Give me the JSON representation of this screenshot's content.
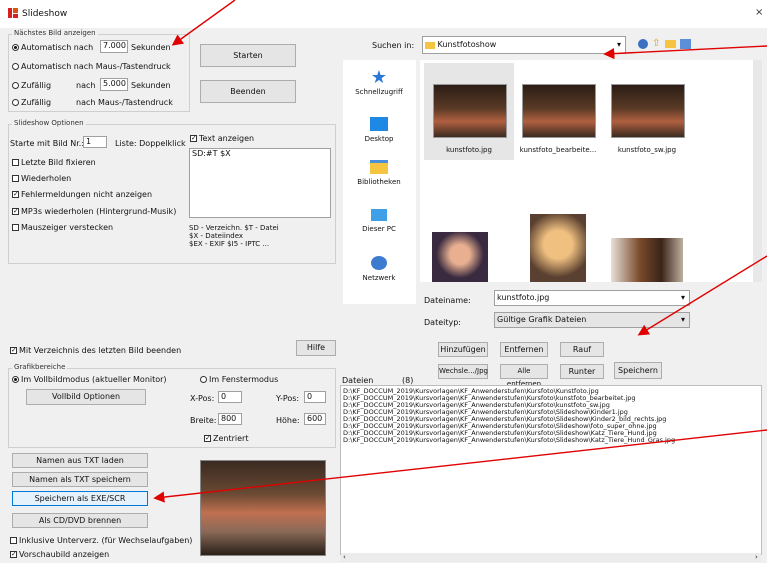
{
  "window": {
    "title": "Slideshow",
    "close": "×"
  },
  "timing": {
    "group_label": "Nächstes Bild anzeigen",
    "auto_prefix": "Automatisch nach",
    "auto_value": "7.000",
    "auto_suffix": "Sekunden",
    "manual_label": "Automatisch nach Maus-/Tastendruck",
    "random_prefix": "Zufällig",
    "random_mid": "nach",
    "random_value": "5.000",
    "random_suffix": "Sekunden",
    "random2_prefix": "Zufällig",
    "random2_label": "nach Maus-/Tastendruck"
  },
  "buttons": {
    "start": "Starten",
    "end": "Beenden",
    "help": "Hilfe"
  },
  "options": {
    "group_label": "Slideshow Optionen",
    "start_prefix": "Starte mit Bild Nr.:",
    "start_value": "1",
    "start_suffix": "Liste: Doppelklick",
    "items": [
      "Letzte Bild fixieren",
      "Wiederholen",
      "Fehlermeldungen nicht anzeigen",
      "MP3s wiederholen (Hintergrund-Musik)",
      "Mauszeiger verstecken"
    ],
    "text_show_label": "Text anzeigen",
    "text_value": "SD:#T $X",
    "legend": [
      "SD - Verzeichn. $T - Datei",
      "$X - Dateiindex",
      "$EX - EXIF $I5 - IPTC ..."
    ]
  },
  "browser": {
    "search_label": "Suchen in:",
    "folder": "Kunstfotoshow",
    "nav": [
      "Schnellzugriff",
      "Desktop",
      "Bibliotheken",
      "Dieser PC",
      "Netzwerk"
    ],
    "thumbs": [
      "kunstfoto.jpg",
      "kunstfoto_bearbeite...",
      "kunstfoto_sw.jpg"
    ],
    "filename_label": "Dateiname:",
    "filename_value": "kunstfoto.jpg",
    "filetype_label": "Dateityp:",
    "filetype_value": "Gültige Grafik Dateien"
  },
  "list_buttons": {
    "add": "Hinzufügen",
    "remove": "Entfernen",
    "up": "Rauf",
    "replace": "Wechsle.../Jpg",
    "new": "Alle entfernen",
    "down": "Runter",
    "save": "Speichern"
  },
  "last_image_label": "Mit Verzeichnis des letzten Bild beenden",
  "display": {
    "group_label": "Grafikbereiche",
    "full_label": "Im Vollbildmodus (aktueller Monitor)",
    "window_label": "Im Fenstermodus",
    "full_colors_btn": "Vollbild Optionen",
    "x_label": "X-Pos:",
    "x_value": "0",
    "y_label": "Y-Pos:",
    "y_value": "0",
    "w_label": "Breite:",
    "w_value": "800",
    "h_label": "Höhe:",
    "h_value": "600",
    "center_label": "Zentriert"
  },
  "txt_buttons": [
    "Namen aus TXT laden",
    "Namen als TXT speichern",
    "Speichern als EXE/SCR",
    "Als CD/DVD brennen"
  ],
  "bottom_checks": [
    "Inklusive Unterverz. (für Wechselaufgaben)",
    "Vorschaubild anzeigen"
  ],
  "files": {
    "header_label": "Dateien",
    "count": "(8)",
    "lines": [
      "D:\\KF_DOCCUM_2019\\Kursvorlagen\\KF_Anwenderstufen\\Kursfoto\\Kunstfoto.jpg",
      "D:\\KF_DOCCUM_2019\\Kursvorlagen\\KF_Anwenderstufen\\Kursfoto\\kunstfoto_bearbeitet.jpg",
      "D:\\KF_DOCCUM_2019\\Kursvorlagen\\KF_Anwenderstufen\\Kursfoto\\kunstfoto_sw.jpg",
      "D:\\KF_DOCCUM_2019\\Kursvorlagen\\KF_Anwenderstufen\\Kursfoto\\Slideshow\\Kinder1.jpg",
      "D:\\KF_DOCCUM_2019\\Kursvorlagen\\KF_Anwenderstufen\\Kursfoto\\Slideshow\\Kinder2_bild_rechts.jpg",
      "D:\\KF_DOCCUM_2019\\Kursvorlagen\\KF_Anwenderstufen\\Kursfoto\\Slideshow\\foto_super_ohne.jpg",
      "D:\\KF_DOCCUM_2019\\Kursvorlagen\\KF_Anwenderstufen\\Kursfoto\\Slideshow\\Katz_Tiere_Hund.jpg",
      "D:\\KF_DOCCUM_2019\\Kursvorlagen\\KF_Anwenderstufen\\Kursfoto\\Slideshow\\Katz_Tiere_Hund_Gras.jpg"
    ]
  },
  "colors": {
    "accent": "#0078d7",
    "arrow": "#e00000",
    "selected_thumb": "#cce8ff"
  }
}
